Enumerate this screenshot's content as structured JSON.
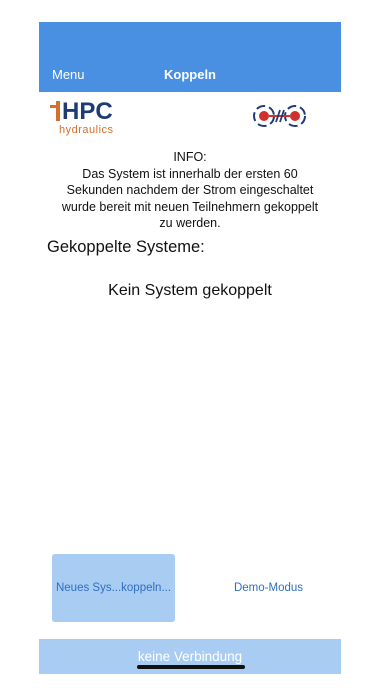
{
  "navbar": {
    "left_label": "Menu",
    "title": "Koppeln"
  },
  "logos": {
    "hpc_text": "HPC",
    "hpc_sub": "hydraulics"
  },
  "info": {
    "line1": "INFO:",
    "line2": "Das System ist innerhalb der ersten 60",
    "line3": "Sekunden nachdem der Strom eingeschaltet",
    "line4": "wurde bereit mit neuen Teilnehmern gekoppelt",
    "line5": "zu werden."
  },
  "section_title": "Gekoppelte Systeme:",
  "empty_message": "Kein System gekoppelt",
  "buttons": {
    "new_system": "Neues Sys...koppeln...",
    "demo": "Demo-Modus"
  },
  "status": {
    "text": "keine Verbindung"
  },
  "colors": {
    "accent": "#4a90e2",
    "light_accent": "#a8ccf2",
    "logo_orange": "#d4702b",
    "logo_navy": "#1f3b73",
    "link_red": "#d0312d"
  }
}
